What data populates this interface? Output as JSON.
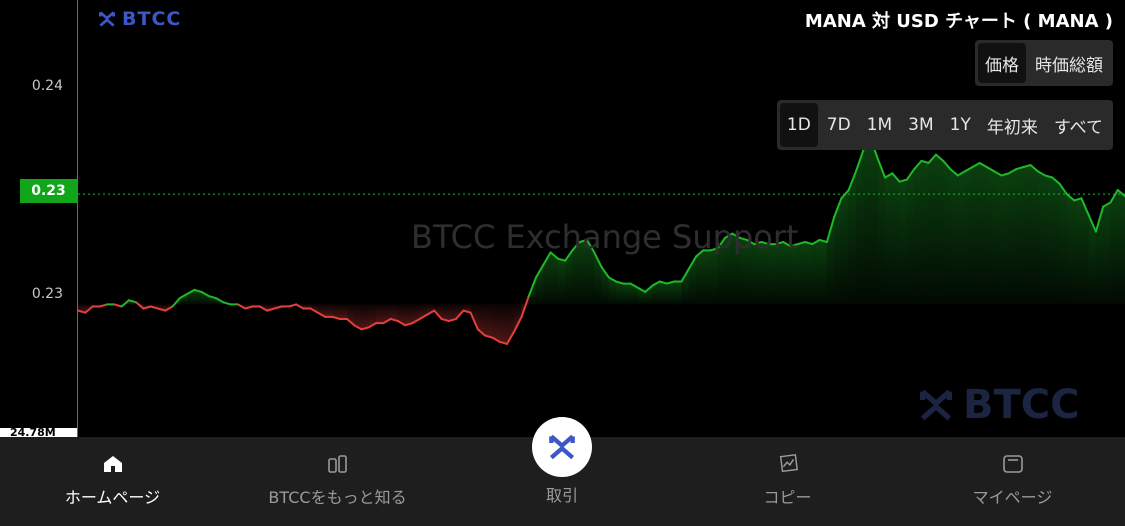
{
  "header": {
    "logo_text": "BTCC",
    "title": "MANA 対 USD チャート ( MANA )"
  },
  "price_toggle": {
    "options": [
      "価格",
      "時価総額"
    ],
    "selected": "価格"
  },
  "range_toggle": {
    "options": [
      "1D",
      "7D",
      "1M",
      "3M",
      "1Y",
      "年初来",
      "すべて"
    ],
    "selected": "1D"
  },
  "axis": {
    "ticks": [
      "0.24",
      "0.23"
    ],
    "current_price": "0.23",
    "volume_label": "24.78M"
  },
  "watermark": {
    "text": "BTCC Exchange Support",
    "logo_text": "BTCC"
  },
  "colors": {
    "up": "#1fb82a",
    "down": "#e2403f",
    "current": "#11a61a",
    "brand": "#3e57c7"
  },
  "nav": {
    "home": "ホームページ",
    "learn": "BTCCをもっと知る",
    "trade": "取引",
    "copy": "コピー",
    "mypage": "マイページ"
  },
  "nav_icons": [
    "home-icon",
    "learn-icon",
    "trade-icon",
    "copy-icon",
    "wallet-icon"
  ],
  "chart_data": {
    "type": "area",
    "baseline": 0.2295,
    "y_ticks": [
      0.24,
      0.235,
      0.23
    ],
    "y_tick_labels": [
      "0.24",
      "0.23",
      "0.23"
    ],
    "current": 0.2348,
    "x": [
      0,
      2,
      4,
      6,
      8,
      10,
      12,
      14,
      16,
      18,
      20,
      22,
      24,
      26,
      28,
      30,
      32,
      34,
      36,
      38,
      40,
      42,
      44,
      46,
      48,
      50,
      52,
      54,
      56,
      58,
      60,
      62,
      64,
      66,
      68,
      70,
      72,
      74,
      76,
      78,
      80,
      82,
      84,
      86,
      88,
      90,
      92,
      94,
      96,
      98,
      100,
      102,
      104,
      106,
      108,
      110,
      112,
      114,
      116,
      118,
      120,
      122,
      124,
      126,
      128,
      130,
      132,
      134,
      136,
      138,
      140,
      142,
      144,
      146,
      148,
      150,
      152,
      154,
      156,
      158,
      160,
      162,
      164,
      166,
      168,
      170,
      172,
      174,
      176,
      178,
      180,
      182,
      184,
      186,
      188,
      190,
      192,
      194,
      196,
      198,
      200,
      202,
      204,
      206,
      208,
      210,
      212,
      214,
      216,
      218,
      220,
      222,
      224,
      226,
      228,
      230,
      232,
      234,
      236,
      238,
      240,
      242,
      244,
      246,
      248,
      250,
      252,
      254,
      256,
      258,
      260,
      262,
      264,
      266,
      268,
      270,
      272,
      274,
      276,
      278,
      280,
      282,
      284,
      286,
      288
    ],
    "y": [
      0.2292,
      0.2291,
      0.2294,
      0.2294,
      0.2295,
      0.2295,
      0.2294,
      0.2297,
      0.2296,
      0.2293,
      0.2294,
      0.2293,
      0.2292,
      0.2294,
      0.2298,
      0.23,
      0.2302,
      0.2301,
      0.2299,
      0.2298,
      0.2296,
      0.2295,
      0.2295,
      0.2293,
      0.2294,
      0.2294,
      0.2292,
      0.2293,
      0.2294,
      0.2294,
      0.2295,
      0.2293,
      0.2293,
      0.2291,
      0.2289,
      0.2289,
      0.2288,
      0.2288,
      0.2285,
      0.2283,
      0.2284,
      0.2286,
      0.2286,
      0.2288,
      0.2287,
      0.2285,
      0.2286,
      0.2288,
      0.229,
      0.2292,
      0.2288,
      0.2287,
      0.2288,
      0.2292,
      0.2291,
      0.2283,
      0.228,
      0.2279,
      0.2277,
      0.2276,
      0.2282,
      0.2289,
      0.2299,
      0.2308,
      0.2314,
      0.232,
      0.2317,
      0.2316,
      0.2321,
      0.2325,
      0.2326,
      0.232,
      0.2313,
      0.2308,
      0.2306,
      0.2305,
      0.2305,
      0.2303,
      0.2301,
      0.2304,
      0.2306,
      0.2305,
      0.2306,
      0.2306,
      0.2312,
      0.2318,
      0.2321,
      0.2321,
      0.2322,
      0.2327,
      0.2329,
      0.2327,
      0.2326,
      0.2324,
      0.2325,
      0.2324,
      0.2324,
      0.2325,
      0.2323,
      0.2324,
      0.2325,
      0.2324,
      0.2326,
      0.2325,
      0.2337,
      0.2346,
      0.235,
      0.2359,
      0.2369,
      0.2375,
      0.2365,
      0.2356,
      0.2358,
      0.2354,
      0.2355,
      0.236,
      0.2364,
      0.2363,
      0.2367,
      0.2364,
      0.236,
      0.2357,
      0.2359,
      0.2361,
      0.2363,
      0.2361,
      0.2359,
      0.2357,
      0.2358,
      0.236,
      0.2361,
      0.2362,
      0.2359,
      0.2357,
      0.2356,
      0.2353,
      0.2348,
      0.2345,
      0.2346,
      0.2338,
      0.233,
      0.2342,
      0.2344,
      0.235,
      0.2347,
      0.2348
    ]
  }
}
